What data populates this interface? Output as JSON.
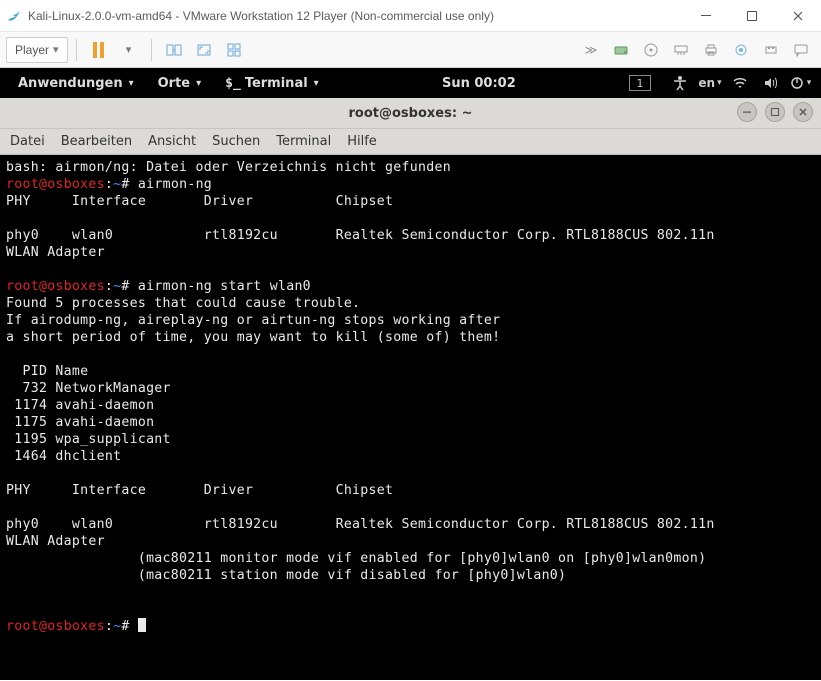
{
  "win": {
    "title": "Kali-Linux-2.0.0-vm-amd64 - VMware Workstation 12 Player (Non-commercial use only)"
  },
  "vm": {
    "player_label": "Player"
  },
  "kali": {
    "apps": "Anwendungen",
    "places": "Orte",
    "terminal": "Terminal",
    "clock": "Sun 00:02",
    "workspace": "1",
    "lang": "en"
  },
  "term": {
    "title": "root@osboxes: ~",
    "menu": {
      "file": "Datei",
      "edit": "Bearbeiten",
      "view": "Ansicht",
      "search": "Suchen",
      "terminal": "Terminal",
      "help": "Hilfe"
    },
    "prompt_user": "root",
    "prompt_host": "osboxes",
    "prompt_path": "~",
    "lines": {
      "l1": "bash: airmon/ng: Datei oder Verzeichnis nicht gefunden",
      "cmd1": " airmon-ng",
      "hdr": "PHY     Interface       Driver          Chipset",
      "phy_a1": "phy0    wlan0           rtl8192cu       Realtek Semiconductor Corp. RTL8188CUS 802.11n",
      "phy_a2": "WLAN Adapter",
      "cmd2": " airmon-ng start wlan0",
      "f1": "Found 5 processes that could cause trouble.",
      "f2": "If airodump-ng, aireplay-ng or airtun-ng stops working after",
      "f3": "a short period of time, you may want to kill (some of) them!",
      "pidh": "  PID Name",
      "p1": "  732 NetworkManager",
      "p2": " 1174 avahi-daemon",
      "p3": " 1175 avahi-daemon",
      "p4": " 1195 wpa_supplicant",
      "p5": " 1464 dhclient",
      "phy_b1": "phy0    wlan0           rtl8192cu       Realtek Semiconductor Corp. RTL8188CUS 802.11n",
      "phy_b2": "WLAN Adapter",
      "m1": "                (mac80211 monitor mode vif enabled for [phy0]wlan0 on [phy0]wlan0mon)",
      "m2": "                (mac80211 station mode vif disabled for [phy0]wlan0)"
    }
  }
}
